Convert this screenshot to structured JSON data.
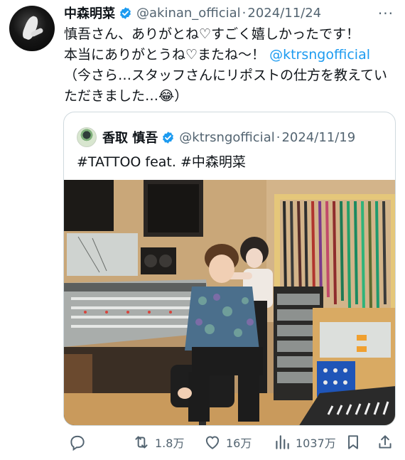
{
  "tweet": {
    "author_name": "中森明菜",
    "handle": "@akinan_official",
    "separator": "·",
    "date": "2024/11/24",
    "more_label": "···",
    "text_line1": "慎吾さん、ありがとね♡すごく嬉しかったです！",
    "text_line2": "本当にありがとうね♡またね〜！",
    "text_mention": "@ktrsngofficial",
    "text_line3": "（今さら…スタッフさんにリポストの仕方を教えていただきました…😂）"
  },
  "quoted": {
    "author_name": "香取 慎吾",
    "handle": "@ktrsngofficial",
    "separator": "·",
    "date": "2024/11/19",
    "text": "#TATTOO feat. #中森明菜"
  },
  "actions": {
    "reposts": "1.8万",
    "likes": "16万",
    "views": "1037万"
  },
  "colors": {
    "accent": "#1d9bf0",
    "secondary_text": "#536471",
    "border": "#cfd9de"
  }
}
